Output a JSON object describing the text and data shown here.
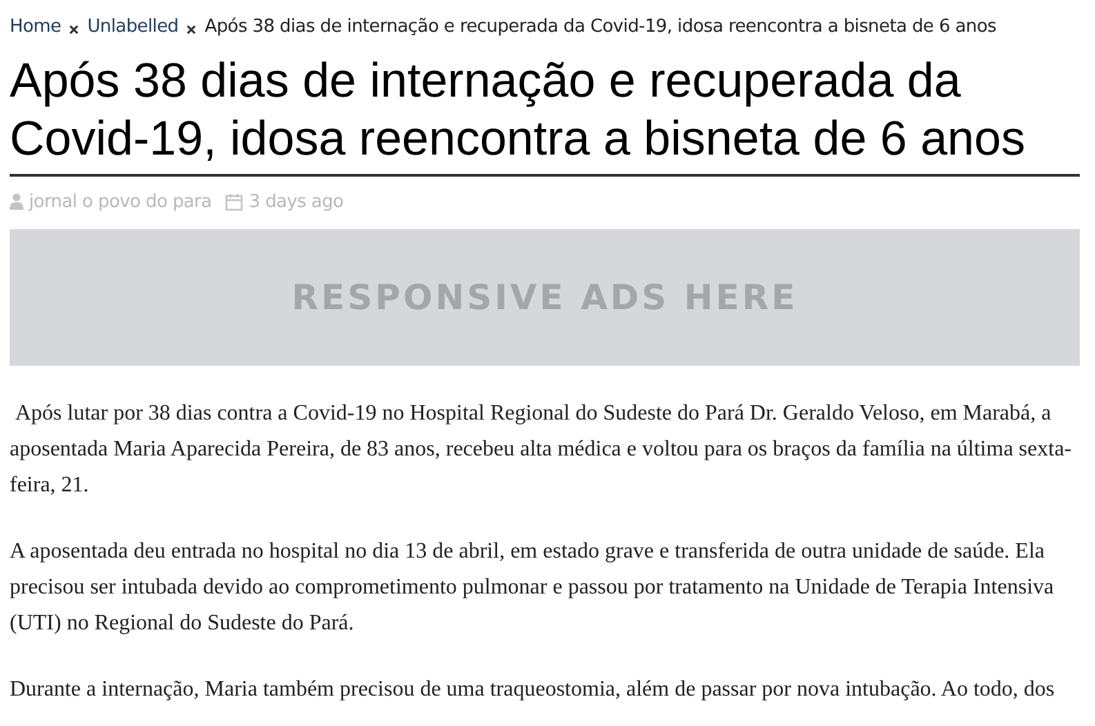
{
  "breadcrumb": [
    {
      "label": "Home",
      "link": true
    },
    {
      "label": "Unlabelled",
      "link": true
    },
    {
      "label": "Após 38 dias de internação e recuperada da Covid-19, idosa reencontra a bisneta de 6 anos",
      "link": false
    }
  ],
  "title": "Após 38 dias de internação e recuperada da Covid-19, idosa reencontra a bisneta de 6 anos",
  "meta": {
    "author": "jornal o povo do para",
    "date": "3 days ago"
  },
  "ad": {
    "text": "RESPONSIVE ADS HERE"
  },
  "paragraphs": [
    " Após lutar por 38 dias contra a Covid-19 no Hospital Regional do Sudeste do Pará Dr. Geraldo Veloso, em Marabá, a aposentada Maria Aparecida Pereira, de 83 anos, recebeu alta médica e voltou para os braços da família na última sexta-feira, 21.",
    "A aposentada deu entrada no hospital no dia 13 de abril, em estado grave e transferida de outra unidade de saúde. Ela precisou ser intubada devido ao comprometimento pulmonar e passou por tratamento na Unidade de Terapia Intensiva (UTI) no Regional do Sudeste do Pará.",
    "Durante a internação, Maria também precisou de uma traqueostomia, além de passar por nova intubação. Ao todo, dos"
  ]
}
